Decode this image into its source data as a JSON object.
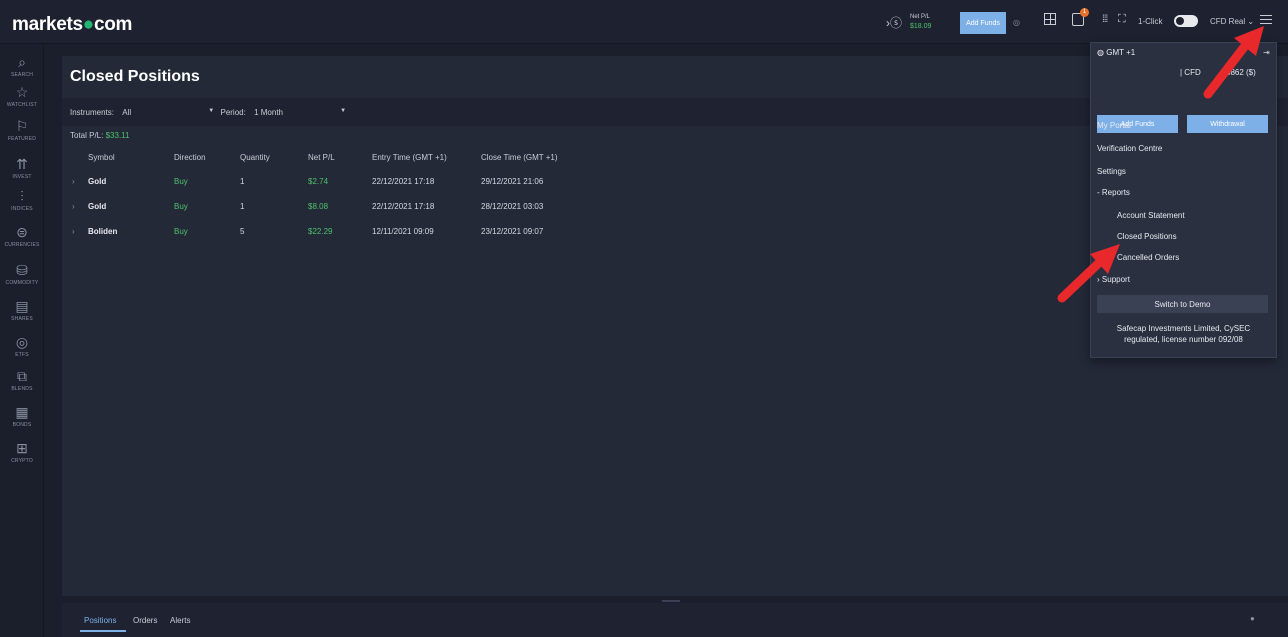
{
  "brand": {
    "pre": "markets",
    "dot": "●",
    "post": "com"
  },
  "header": {
    "net_pl_label": "Net P/L",
    "net_pl_value": "$18.09",
    "add_funds": "Add Funds",
    "one_click": "1-Click",
    "account": "CFD Real",
    "notification_count": "1"
  },
  "sidebar": [
    {
      "label": "SEARCH",
      "icon": "search-icon",
      "glyph": "⌕"
    },
    {
      "label": "WATCHLIST",
      "icon": "star-icon",
      "glyph": "☆"
    },
    {
      "label": "FEATURED",
      "icon": "flag-icon",
      "glyph": "⚐"
    },
    {
      "label": "INVEST",
      "icon": "invest-icon",
      "glyph": "⇈"
    },
    {
      "label": "INDICES",
      "icon": "indices-icon",
      "glyph": "⫶"
    },
    {
      "label": "CURRENCIES",
      "icon": "currencies-icon",
      "glyph": "⊜"
    },
    {
      "label": "COMMODITY",
      "icon": "commodity-icon",
      "glyph": "⛁"
    },
    {
      "label": "SHARES",
      "icon": "shares-icon",
      "glyph": "▤"
    },
    {
      "label": "ETFS",
      "icon": "etfs-icon",
      "glyph": "◎"
    },
    {
      "label": "BLENDS",
      "icon": "blends-icon",
      "glyph": "⧉"
    },
    {
      "label": "BONDS",
      "icon": "bonds-icon",
      "glyph": "▦"
    },
    {
      "label": "CRYPTO",
      "icon": "crypto-icon",
      "glyph": "⊞"
    }
  ],
  "page": {
    "title": "Closed Positions",
    "instruments_label": "Instruments:",
    "instruments_value": "All",
    "period_label": "Period:",
    "period_value": "1 Month",
    "total_label": "Total P/L:",
    "total_value": "$33.11"
  },
  "table": {
    "headers": [
      "Symbol",
      "Direction",
      "Quantity",
      "Net P/L",
      "Entry Time (GMT +1)",
      "Close Time (GMT +1)"
    ],
    "rows": [
      {
        "symbol": "Gold",
        "direction": "Buy",
        "quantity": "1",
        "net_pl": "$2.74",
        "entry": "22/12/2021 17:18",
        "close": "29/12/2021 21:06"
      },
      {
        "symbol": "Gold",
        "direction": "Buy",
        "quantity": "1",
        "net_pl": "$8.08",
        "entry": "22/12/2021 17:18",
        "close": "28/12/2021 03:03"
      },
      {
        "symbol": "Boliden",
        "direction": "Buy",
        "quantity": "5",
        "net_pl": "$22.29",
        "entry": "12/11/2021 09:09",
        "close": "23/12/2021 09:07"
      }
    ]
  },
  "bottom_tabs": [
    "Positions",
    "Orders",
    "Alerts"
  ],
  "menu": {
    "timezone": "GMT +1",
    "account_line_a": "| CFD",
    "account_line_b": "0862 ($)",
    "add_funds": "Add Funds",
    "withdrawal": "Withdrawal",
    "my_portal": "My Portal",
    "verification": "Verification Centre",
    "settings": "Settings",
    "reports": "Reports",
    "account_statement": "Account Statement",
    "closed_positions": "Closed Positions",
    "cancelled_orders": "Cancelled Orders",
    "support": "Support",
    "switch_demo": "Switch to Demo",
    "footer_line1": "Safecap Investments Limited, CySEC",
    "footer_line2": "regulated, license number 092/08"
  },
  "colors": {
    "profit": "#4cc26b",
    "accent": "#7eb0e8",
    "arrow": "#e8282b"
  }
}
